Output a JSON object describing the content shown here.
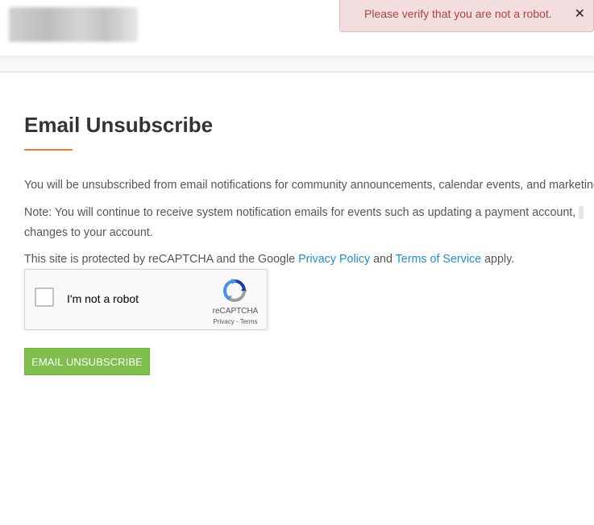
{
  "alert": {
    "message": "Please verify that you are not a robot.",
    "close_glyph": "✕"
  },
  "page": {
    "title": "Email Unsubscribe",
    "accent_color": "#e0803a"
  },
  "content": {
    "paragraph1": "You will be unsubscribed from email notifications for community announcements, calendar events, and marketing",
    "paragraph2_line1": "Note: You will continue to receive system notification emails for events such as updating a payment account,",
    "paragraph2_line2": "changes to your account.",
    "recaptcha_notice": {
      "prefix": "This site is protected by reCAPTCHA and the Google ",
      "privacy_link": "Privacy Policy",
      "middle": " and ",
      "terms_link": "Terms of Service",
      "suffix": " apply."
    }
  },
  "recaptcha": {
    "checkbox_label": "I'm not a robot",
    "brand": "reCAPTCHA",
    "terms": "Privacy - Terms",
    "icon": "recaptcha-logo-icon"
  },
  "actions": {
    "submit_label": "EMAIL UNSUBSCRIBE",
    "submit_color": "#7fbf4d"
  }
}
